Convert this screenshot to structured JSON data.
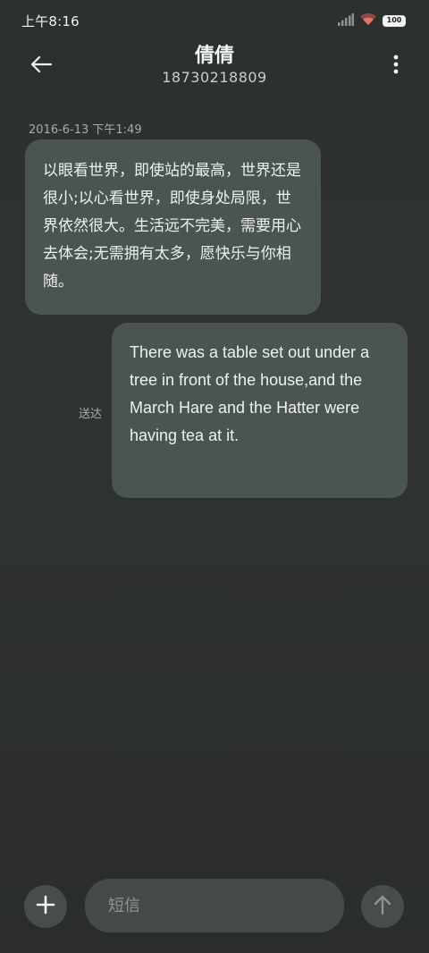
{
  "status_bar": {
    "time": "上午8:16",
    "battery_level": "100",
    "icons": [
      "signal-icon",
      "wifi-icon",
      "battery-icon"
    ]
  },
  "header": {
    "contact_name": "倩倩",
    "contact_number": "18730218809",
    "icons": [
      "back-arrow-icon",
      "more-vertical-icon"
    ]
  },
  "conversation": {
    "timestamp": "2016-6-13 下午1:49",
    "messages": [
      {
        "direction": "incoming",
        "text": "以眼看世界，即使站的最高，世界还是很小;以心看世界，即使身处局限，世界依然很大。生活远不完美，需要用心去体会;无需拥有太多，愿快乐与你相随。"
      },
      {
        "direction": "outgoing",
        "text": "There was a table set out under a tree in front of the house,and the March Hare and the Hatter were having tea at it.",
        "status": "送达"
      }
    ]
  },
  "composer": {
    "placeholder": "短信",
    "value": "",
    "icons": [
      "plus-icon",
      "send-arrow-up-icon"
    ]
  },
  "colors": {
    "background": "#2e3231",
    "bubble": "#4a5553",
    "text": "#eef1f0",
    "muted": "#a8adab"
  }
}
